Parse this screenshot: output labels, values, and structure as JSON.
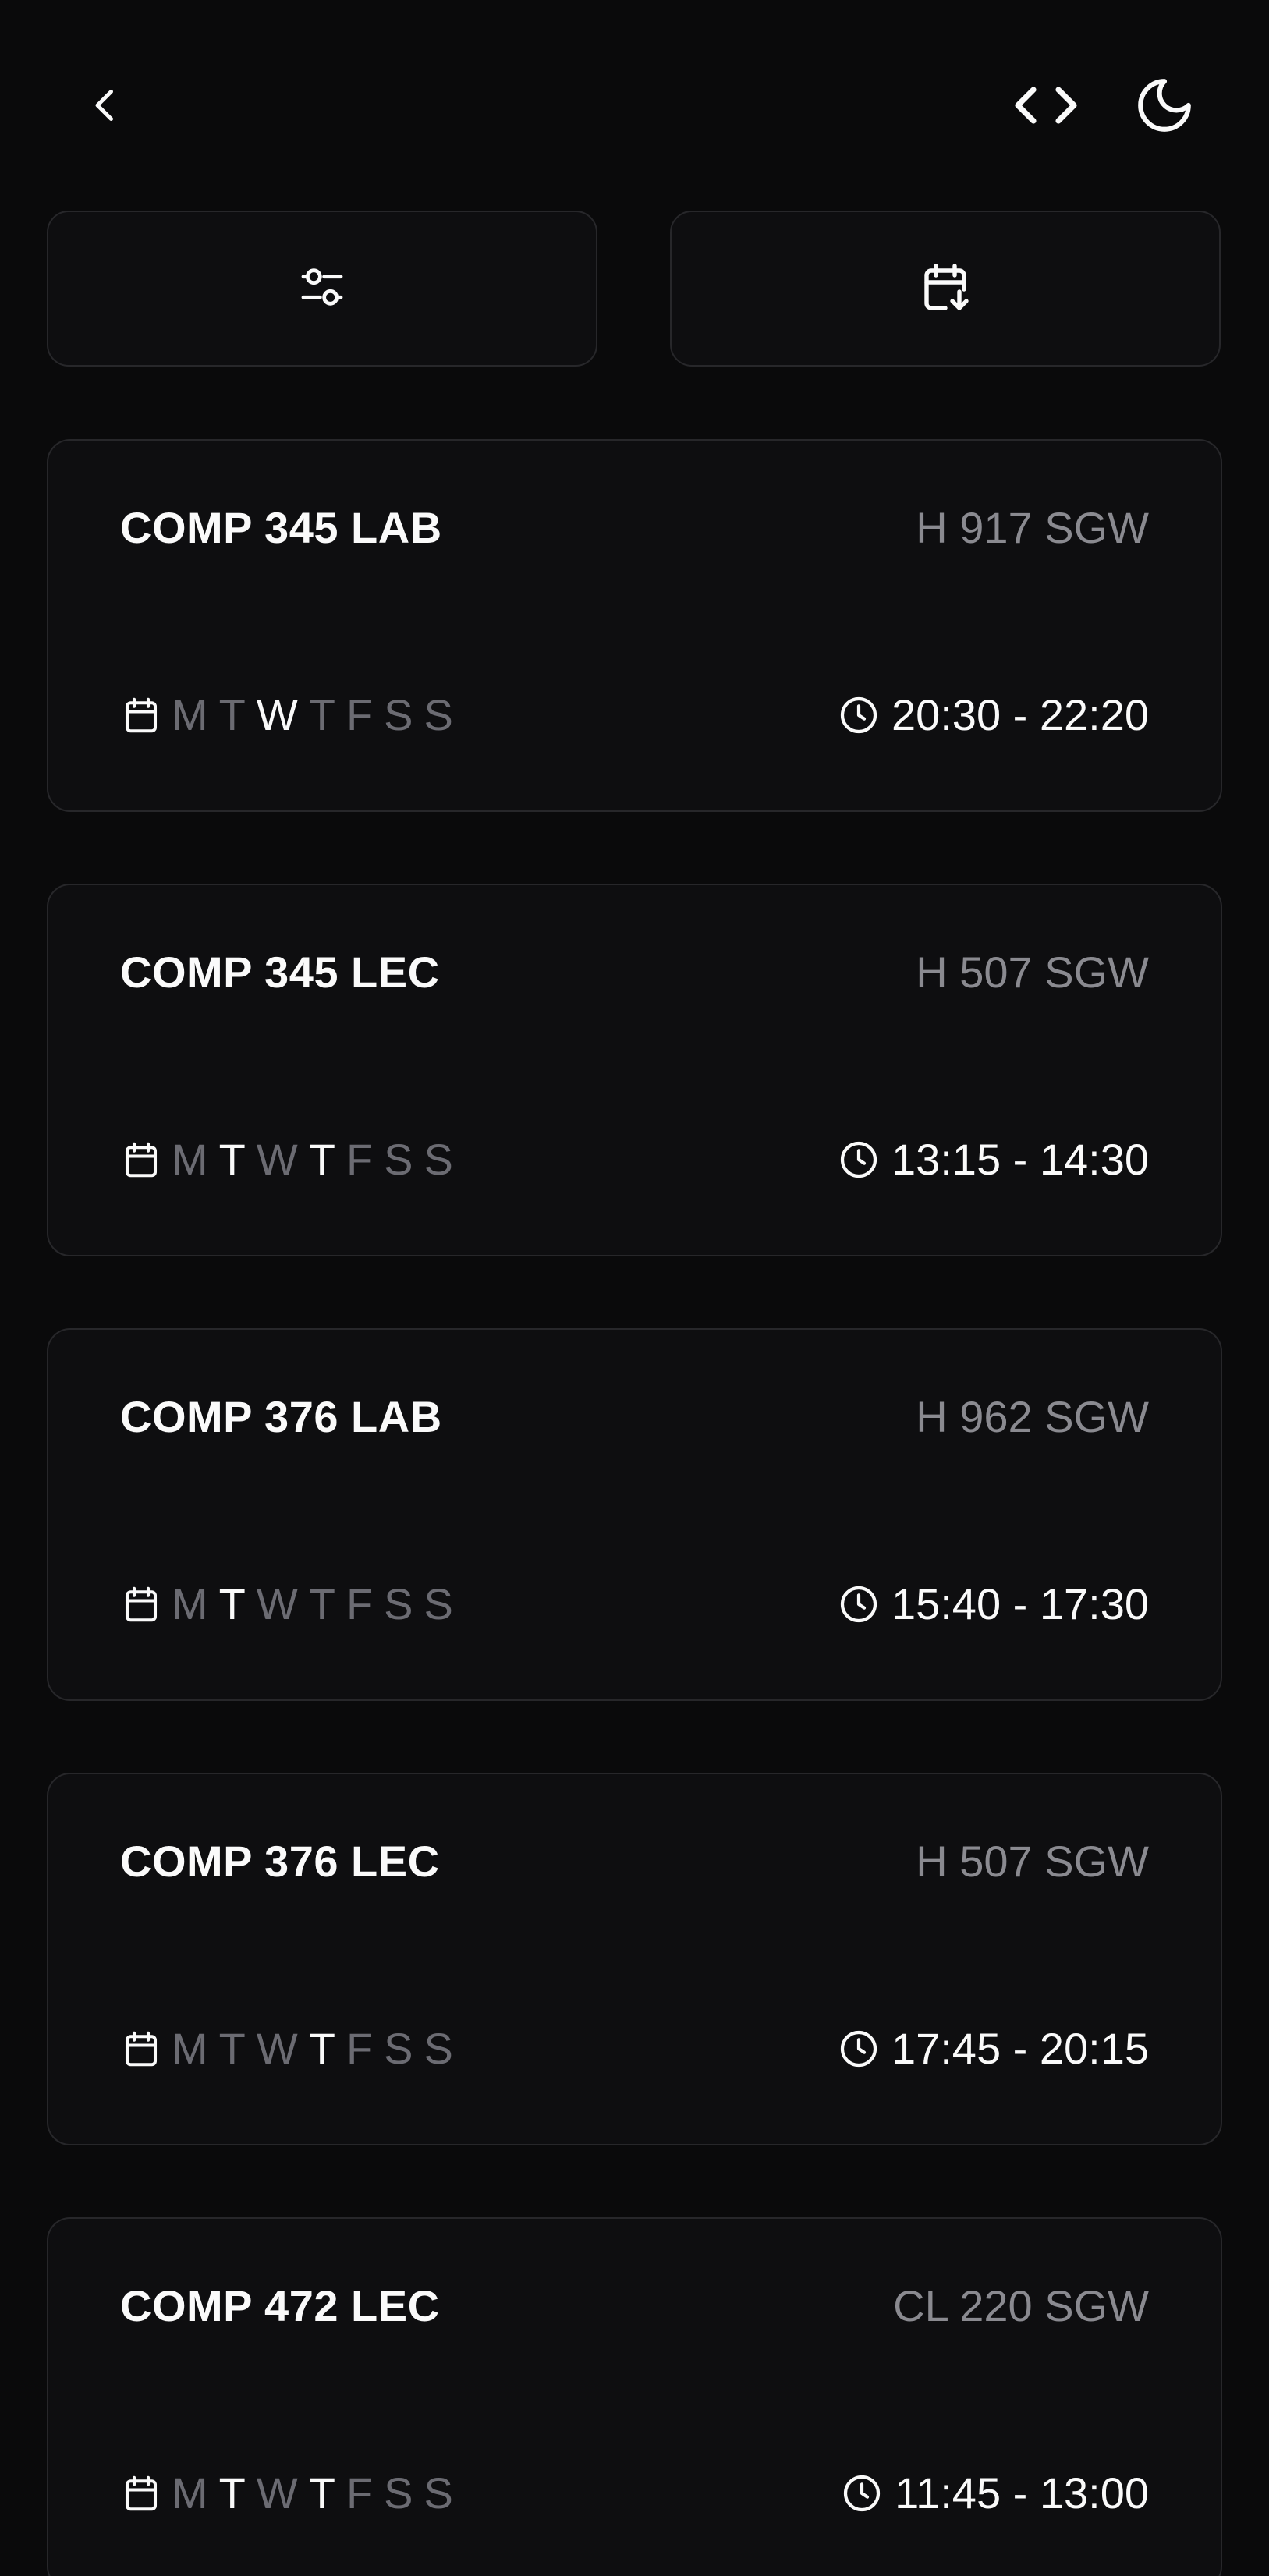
{
  "header": {
    "back_icon": "chevron-left-icon",
    "code_icon": "code-icon",
    "theme_icon": "moon-icon"
  },
  "toolbar": {
    "filter_icon": "sliders-icon",
    "calendar_icon": "calendar-download-icon"
  },
  "colors": {
    "background": "#0a0a0b",
    "card_background": "#0e0e10",
    "border": "#27272a",
    "text_primary": "#fafafa",
    "text_muted": "#8a8a90",
    "day_inactive": "#6b6b72"
  },
  "courses": [
    {
      "name": "COMP 345 LAB",
      "room": "H 917 SGW",
      "days": [
        {
          "label": "M",
          "active": false
        },
        {
          "label": "T",
          "active": false
        },
        {
          "label": "W",
          "active": true
        },
        {
          "label": "T",
          "active": false
        },
        {
          "label": "F",
          "active": false
        },
        {
          "label": "S",
          "active": false
        },
        {
          "label": "S",
          "active": false
        }
      ],
      "time": "20:30 - 22:20"
    },
    {
      "name": "COMP 345 LEC",
      "room": "H 507 SGW",
      "days": [
        {
          "label": "M",
          "active": false
        },
        {
          "label": "T",
          "active": true
        },
        {
          "label": "W",
          "active": false
        },
        {
          "label": "T",
          "active": true
        },
        {
          "label": "F",
          "active": false
        },
        {
          "label": "S",
          "active": false
        },
        {
          "label": "S",
          "active": false
        }
      ],
      "time": "13:15 - 14:30"
    },
    {
      "name": "COMP 376 LAB",
      "room": "H 962 SGW",
      "days": [
        {
          "label": "M",
          "active": false
        },
        {
          "label": "T",
          "active": true
        },
        {
          "label": "W",
          "active": false
        },
        {
          "label": "T",
          "active": false
        },
        {
          "label": "F",
          "active": false
        },
        {
          "label": "S",
          "active": false
        },
        {
          "label": "S",
          "active": false
        }
      ],
      "time": "15:40 - 17:30"
    },
    {
      "name": "COMP 376 LEC",
      "room": "H 507 SGW",
      "days": [
        {
          "label": "M",
          "active": false
        },
        {
          "label": "T",
          "active": false
        },
        {
          "label": "W",
          "active": false
        },
        {
          "label": "T",
          "active": true
        },
        {
          "label": "F",
          "active": false
        },
        {
          "label": "S",
          "active": false
        },
        {
          "label": "S",
          "active": false
        }
      ],
      "time": "17:45 - 20:15"
    },
    {
      "name": "COMP 472 LEC",
      "room": "CL 220 SGW",
      "days": [
        {
          "label": "M",
          "active": false
        },
        {
          "label": "T",
          "active": true
        },
        {
          "label": "W",
          "active": false
        },
        {
          "label": "T",
          "active": true
        },
        {
          "label": "F",
          "active": false
        },
        {
          "label": "S",
          "active": false
        },
        {
          "label": "S",
          "active": false
        }
      ],
      "time": "11:45 - 13:00"
    }
  ]
}
